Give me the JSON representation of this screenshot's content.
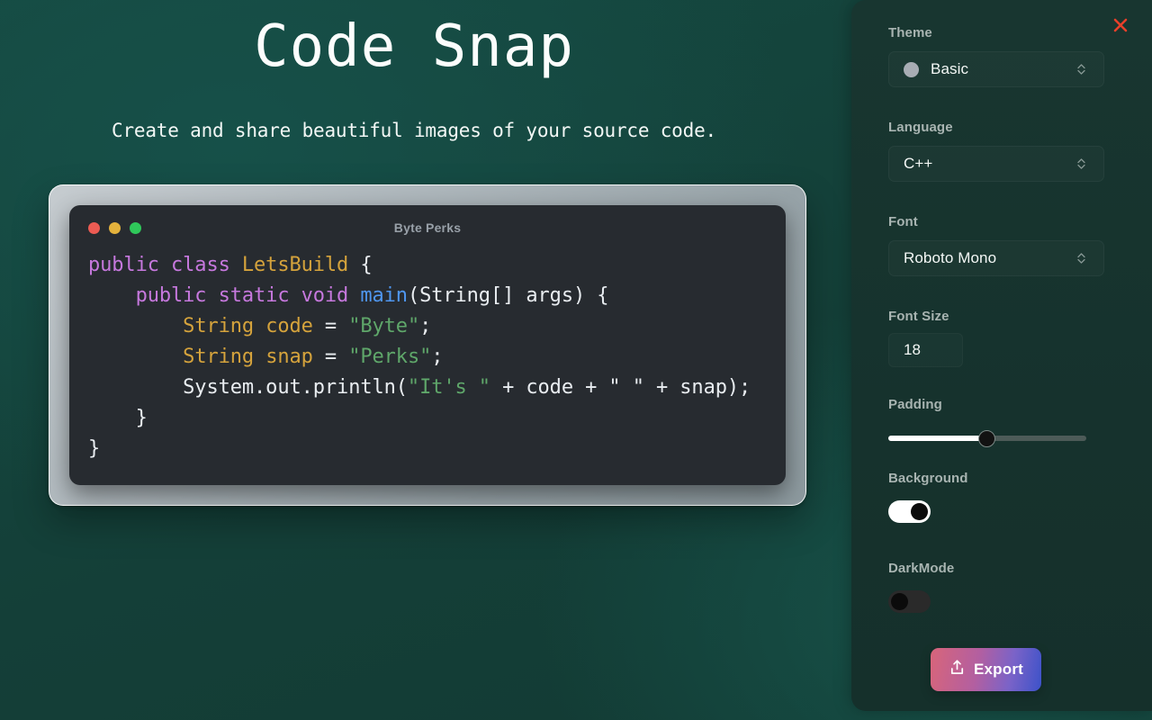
{
  "app": {
    "title": "Code Snap",
    "subtitle": "Create and share beautiful images of your source code."
  },
  "preview": {
    "window_title": "Byte Perks",
    "traffic_lights": [
      "close-dot",
      "minimize-dot",
      "maximize-dot"
    ],
    "code_lines": [
      [
        {
          "text": "public class ",
          "token": "keyword"
        },
        {
          "text": "LetsBuild",
          "token": "type"
        },
        {
          "text": " {",
          "token": "plain"
        }
      ],
      [
        {
          "text": "    public static void ",
          "token": "keyword"
        },
        {
          "text": "main",
          "token": "function"
        },
        {
          "text": "(String[] args) {",
          "token": "plain"
        }
      ],
      [
        {
          "text": "        ",
          "token": "plain"
        },
        {
          "text": "String code ",
          "token": "type"
        },
        {
          "text": "= ",
          "token": "plain"
        },
        {
          "text": "\"Byte\"",
          "token": "string"
        },
        {
          "text": ";",
          "token": "plain"
        }
      ],
      [
        {
          "text": "        ",
          "token": "plain"
        },
        {
          "text": "String snap ",
          "token": "type"
        },
        {
          "text": "= ",
          "token": "plain"
        },
        {
          "text": "\"Perks\"",
          "token": "string"
        },
        {
          "text": ";",
          "token": "plain"
        }
      ],
      [
        {
          "text": "        System.out.println(",
          "token": "plain"
        },
        {
          "text": "\"It's \"",
          "token": "string"
        },
        {
          "text": " + code + \" \" + snap);",
          "token": "plain"
        }
      ],
      [
        {
          "text": "    }",
          "token": "plain"
        }
      ],
      [
        {
          "text": "}",
          "token": "plain"
        }
      ]
    ],
    "colors": {
      "keyword": "#c678dd",
      "type": "#d5a33c",
      "function": "#4f96f0",
      "string": "#5fa76a",
      "plain": "#e9edf1",
      "window_background": "#272b30",
      "frame_gradient_start": "#c6ccd0",
      "frame_gradient_end": "#8d9a9f"
    }
  },
  "sidebar": {
    "close_icon": "close-icon",
    "fields": {
      "theme": {
        "label": "Theme",
        "value": "Basic",
        "swatch_color": "#a8adb4",
        "chevron_icon": "chevron-up-down-icon"
      },
      "language": {
        "label": "Language",
        "value": "C++",
        "chevron_icon": "chevron-up-down-icon"
      },
      "font": {
        "label": "Font",
        "value": "Roboto Mono",
        "chevron_icon": "chevron-up-down-icon"
      },
      "font_size": {
        "label": "Font Size",
        "value": "18"
      },
      "padding": {
        "label": "Padding",
        "percent": 50
      },
      "background": {
        "label": "Background",
        "state": "on"
      },
      "dark_mode": {
        "label": "DarkMode",
        "state": "off"
      }
    },
    "export": {
      "label": "Export",
      "icon": "share-upload-icon",
      "gradient_start": "#d8657a",
      "gradient_end": "#3c52c9"
    }
  },
  "theme_colors": {
    "page_background": "#14443c",
    "panel_background": "#17332e",
    "close_red": "#e8402a"
  }
}
